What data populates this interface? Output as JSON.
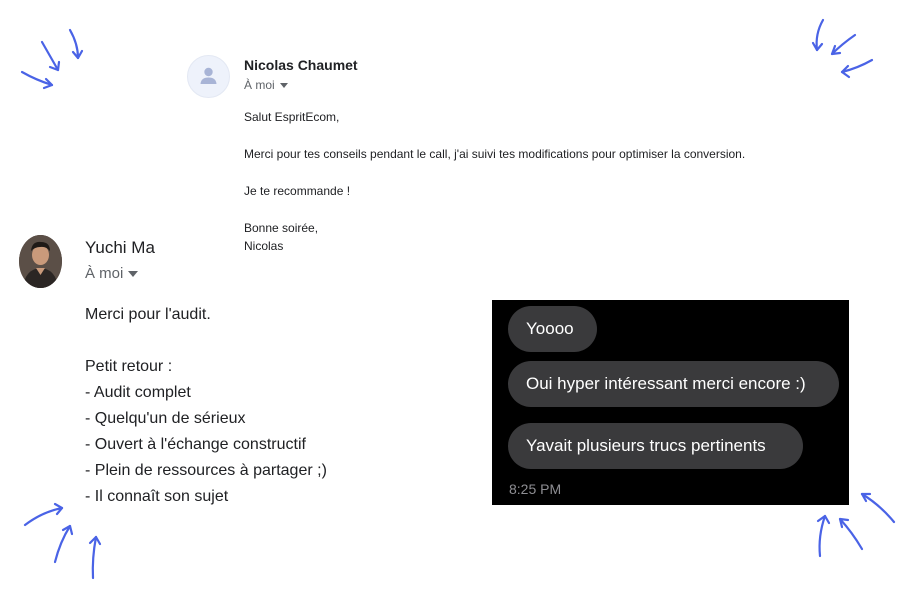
{
  "email_top": {
    "sender": "Nicolas Chaumet",
    "recipient": "À moi",
    "lines": [
      "Salut EspritEcom,",
      "Merci pour tes conseils pendant le call, j'ai suivi tes modifications pour optimiser la conversion.",
      "Je te recommande !",
      "Bonne soirée,",
      "Nicolas"
    ]
  },
  "email_bottom": {
    "sender": "Yuchi Ma",
    "recipient": "À moi",
    "lines": [
      "Merci pour l'audit.",
      "Petit retour :",
      "- Audit complet",
      "- Quelqu'un de sérieux",
      "- Ouvert à l'échange constructif",
      "- Plein de ressources à partager ;)",
      "- Il connaît son sujet"
    ]
  },
  "chat": {
    "messages": [
      "Yoooo",
      "Oui hyper intéressant merci encore :)",
      "Yavait plusieurs trucs pertinents"
    ],
    "time": "8:25 PM",
    "colors": {
      "background": "#000000",
      "bubble": "#3a3a3c",
      "time": "#8e8e93"
    }
  },
  "decoration": {
    "arrow_color": "#4a63e6",
    "arrow_icon": "hand-drawn-arrow-icon"
  }
}
